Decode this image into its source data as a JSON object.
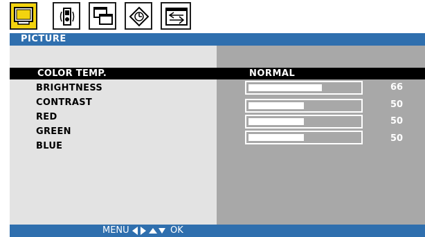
{
  "tabs": [
    {
      "name": "picture-tab",
      "active": true
    },
    {
      "name": "audio-tab",
      "active": false
    },
    {
      "name": "pip-tab",
      "active": false
    },
    {
      "name": "setup-tab",
      "active": false
    },
    {
      "name": "input-tab",
      "active": false
    }
  ],
  "menu": {
    "title": "PICTURE",
    "items": [
      {
        "label": "COLOR TEMP.",
        "value": "NORMAL",
        "selected": true
      },
      {
        "label": "BRIGHTNESS",
        "value": "66",
        "level": 0.66
      },
      {
        "label": "CONTRAST",
        "value": "50",
        "level": 0.5
      },
      {
        "label": "RED",
        "value": "50",
        "level": 0.5
      },
      {
        "label": "GREEN",
        "value": "50",
        "level": 0.5
      },
      {
        "label": "BLUE",
        "value": null
      }
    ]
  },
  "footer": {
    "menu_label": "MENU",
    "ok_label": "OK"
  },
  "colors": {
    "accent_blue": "#2f6fae",
    "active_tab": "#f2d30f",
    "left_panel": "#e3e3e3",
    "right_panel": "#a8a8a8"
  }
}
